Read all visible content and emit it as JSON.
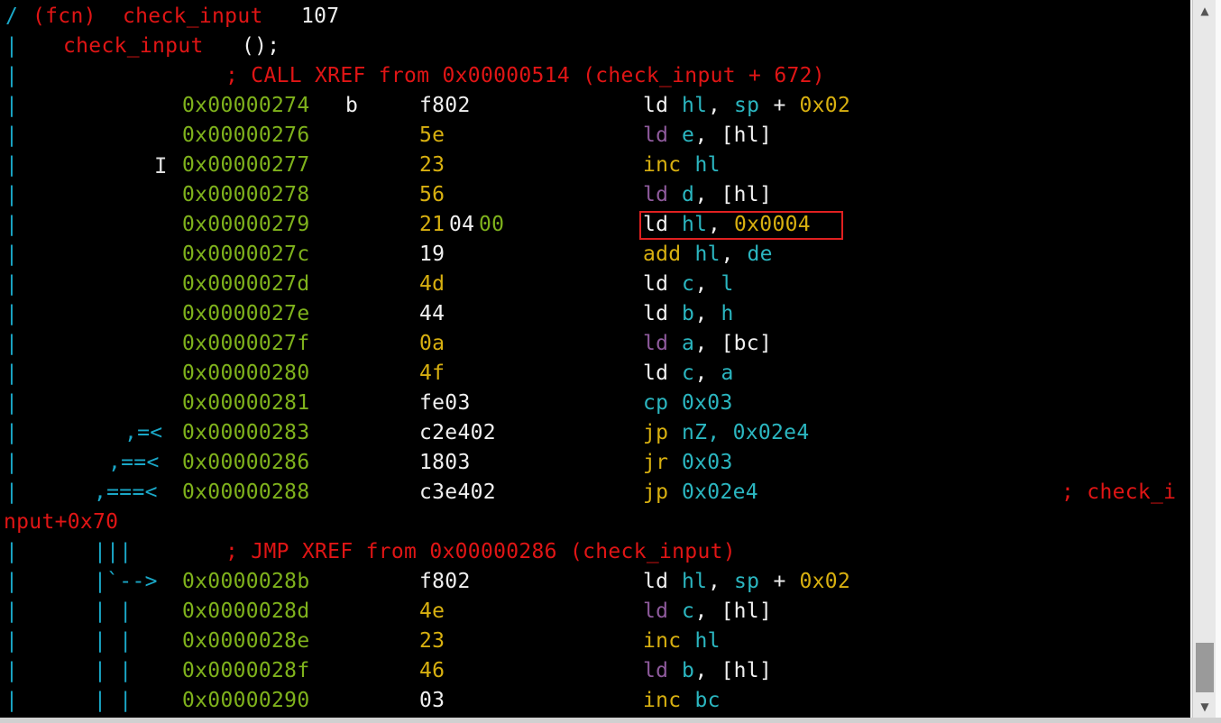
{
  "header": {
    "line1": {
      "slash": "/",
      "fcn": "(fcn)",
      "name": "check_input",
      "size": "107"
    },
    "line2": {
      "bar": "|",
      "name": "check_input",
      "parens": "();"
    }
  },
  "xref1": "; CALL XREF from 0x00000514 (check_input + 672)",
  "rows1": [
    {
      "addr": "0x00000274",
      "flag": "b",
      "bytes": "f802",
      "m": "ld",
      "a1": "hl",
      "sep": ",",
      "a2": "sp",
      "plus": "+",
      "a3": "0x02"
    },
    {
      "addr": "0x00000276",
      "bytes": "5e",
      "m": "ld",
      "a1": "e",
      "sep": ",",
      "a2": "[hl]"
    },
    {
      "addr": "0x00000277",
      "bytes": "23",
      "m": "inc",
      "a1": "hl"
    },
    {
      "addr": "0x00000278",
      "bytes": "56",
      "m": "ld",
      "a1": "d",
      "sep": ",",
      "a2": "[hl]"
    },
    {
      "addr": "0x00000279",
      "bytes_a": "21",
      "bytes_b": "04",
      "bytes_c": "00",
      "m": "ld",
      "a1": "hl",
      "sep": ",",
      "a2": "0x0004"
    },
    {
      "addr": "0x0000027c",
      "bytes": "19",
      "m": "add",
      "a1": "hl",
      "sep": ",",
      "a2": "de"
    },
    {
      "addr": "0x0000027d",
      "bytes": "4d",
      "m": "ld",
      "a1": "c",
      "sep": ",",
      "a2": "l"
    },
    {
      "addr": "0x0000027e",
      "bytes": "44",
      "m": "ld",
      "a1": "b",
      "sep": ",",
      "a2": "h"
    },
    {
      "addr": "0x0000027f",
      "bytes": "0a",
      "m": "ld",
      "a1": "a",
      "sep": ",",
      "a2": "[bc]"
    },
    {
      "addr": "0x00000280",
      "bytes": "4f",
      "m": "ld",
      "a1": "c",
      "sep": ",",
      "a2": "a"
    },
    {
      "addr": "0x00000281",
      "bytes": "fe03",
      "m": "cp",
      "a1": "0x03"
    },
    {
      "addr": "0x00000283",
      "arrow": ",=<",
      "bytes": "c2e402",
      "m": "jp",
      "a1": "nZ, 0x02e4"
    },
    {
      "addr": "0x00000286",
      "arrow": ",==<",
      "bytes": "1803",
      "m": "jr",
      "a1": "0x03"
    },
    {
      "addr": "0x00000288",
      "arrow": ",===<",
      "bytes": "c3e402",
      "m": "jp",
      "a1": "0x02e4",
      "comment": "; check_i"
    }
  ],
  "wrap": "nput+0x70",
  "xref2_bars": "|||",
  "xref2": "; JMP XREF from 0x00000286 (check_input)",
  "rows2": [
    {
      "addr": "0x0000028b",
      "arrow": "|`-->",
      "bytes": "f802",
      "m": "ld",
      "a1": "hl",
      "sep": ",",
      "a2": "sp",
      "plus": "+",
      "a3": "0x02"
    },
    {
      "addr": "0x0000028d",
      "arrow": "| |",
      "bytes": "4e",
      "m": "ld",
      "a1": "c",
      "sep": ",",
      "a2": "[hl]"
    },
    {
      "addr": "0x0000028e",
      "arrow": "| |",
      "bytes": "23",
      "m": "inc",
      "a1": "hl"
    },
    {
      "addr": "0x0000028f",
      "arrow": "| |",
      "bytes": "46",
      "m": "ld",
      "a1": "b",
      "sep": ",",
      "a2": "[hl]"
    },
    {
      "addr": "0x00000290",
      "arrow": "| |",
      "bytes": "03",
      "m": "inc",
      "a1": "bc"
    }
  ],
  "gutter": "|",
  "scrollbar": {
    "up": "▲",
    "down": "▼"
  }
}
